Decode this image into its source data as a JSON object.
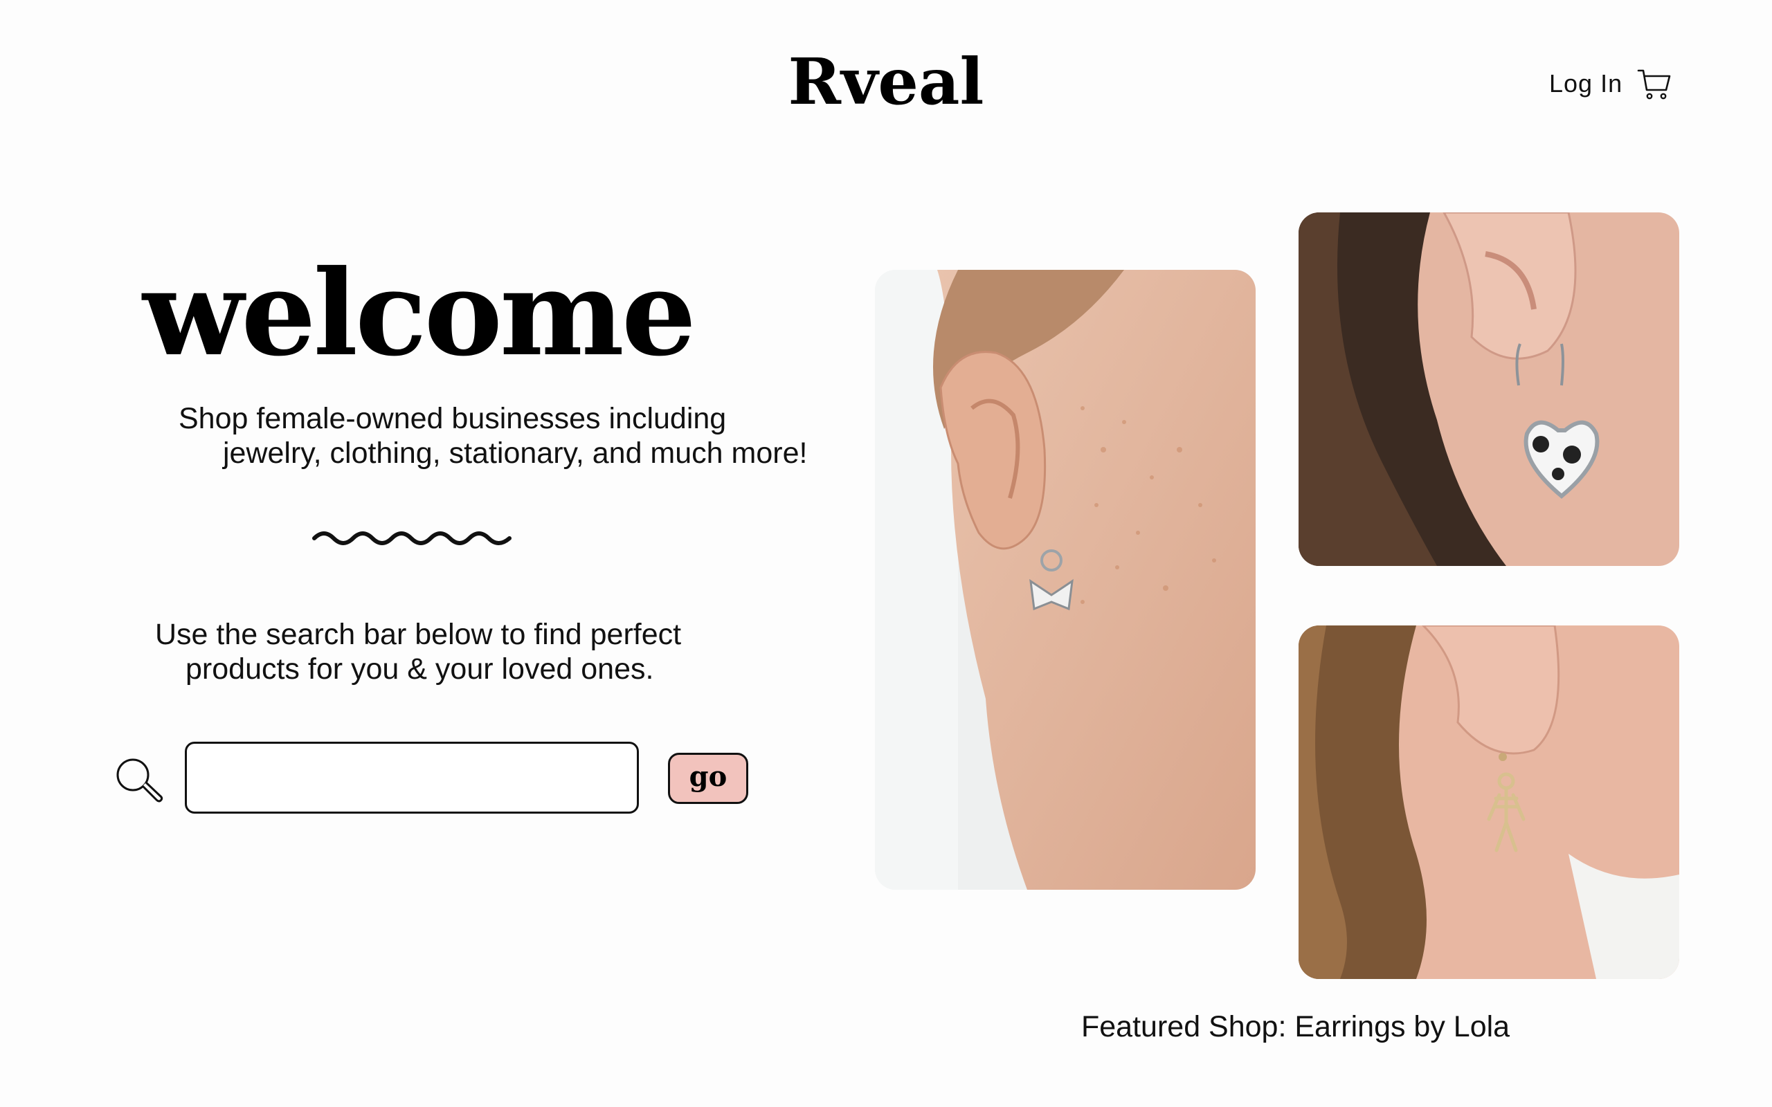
{
  "header": {
    "brand": "Rveal",
    "login_label": "Log In",
    "cart_icon": "cart-icon"
  },
  "hero": {
    "heading": "welcome",
    "tagline_line1": "Shop female-owned businesses including",
    "tagline_line2": "jewelry, clothing, stationary, and much more!",
    "instructions_line1": "Use the search bar below to find perfect",
    "instructions_line2": "products for you & your loved ones."
  },
  "search": {
    "icon": "search-icon",
    "value": "",
    "placeholder": "",
    "button_label": "go"
  },
  "featured": {
    "caption": "Featured Shop: Earrings by Lola",
    "photos": [
      "butterfly-earring-photo",
      "heart-earring-photo",
      "skeleton-earring-photo"
    ]
  },
  "colors": {
    "go_button": "#f2c3bd",
    "text": "#111111",
    "background": "#fdfdfd"
  }
}
